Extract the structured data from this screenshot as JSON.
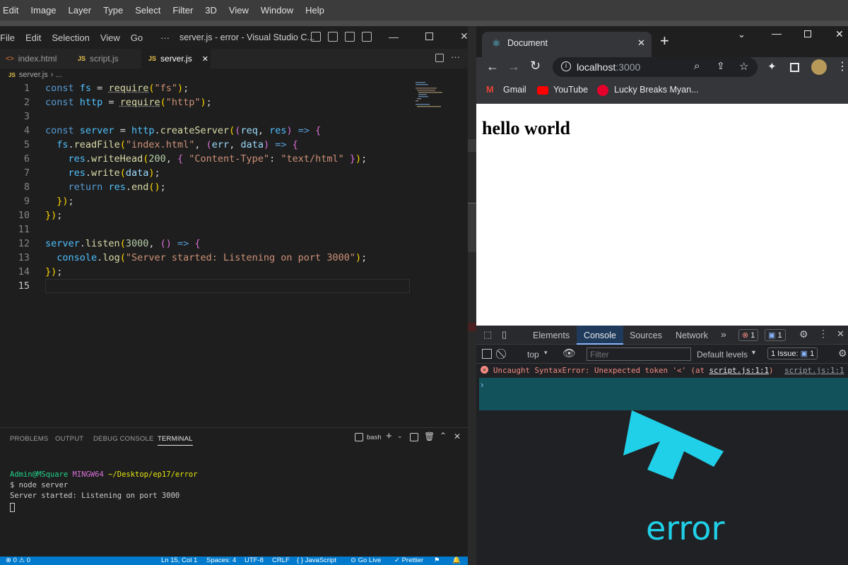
{
  "photoshop": {
    "menu": [
      "Edit",
      "Image",
      "Layer",
      "Type",
      "Select",
      "Filter",
      "3D",
      "View",
      "Window",
      "Help"
    ]
  },
  "vscode": {
    "menu": [
      "File",
      "Edit",
      "Selection",
      "View",
      "Go"
    ],
    "more": "···",
    "window_title": "server.js - error - Visual Studio C...",
    "tabs": [
      {
        "icon": "<>",
        "label": "index.html"
      },
      {
        "icon": "JS",
        "label": "script.js"
      },
      {
        "icon": "JS",
        "label": "server.js",
        "close": "✕"
      }
    ],
    "breadcrumb": {
      "icon": "JS",
      "file": "server.js",
      "rest": "› ..."
    },
    "line_numbers": [
      "1",
      "2",
      "3",
      "4",
      "5",
      "6",
      "7",
      "8",
      "9",
      "10",
      "11",
      "12",
      "13",
      "14",
      "15"
    ],
    "code_lines": [
      "const fs = require(\"fs\");",
      "const http = require(\"http\");",
      "",
      "const server = http.createServer((req, res) => {",
      "  fs.readFile(\"index.html\", (err, data) => {",
      "    res.writeHead(200, { \"Content-Type\": \"text/html\" });",
      "    res.write(data);",
      "    return res.end();",
      "  });",
      "});",
      "",
      "server.listen(3000, () => {",
      "  console.log(\"Server started: Listening on port 3000\");",
      "});",
      ""
    ],
    "panel_tabs": [
      "PROBLEMS",
      "OUTPUT",
      "DEBUG CONSOLE",
      "TERMINAL"
    ],
    "terminal_shell": "bash",
    "terminal": {
      "user": "Admin@MSquare",
      "env": "MINGW64",
      "path": "~/Desktop/ep17/error",
      "command": "$ node server",
      "output": "Server started: Listening on port 3000"
    },
    "status": {
      "problems": "⊗ 0 ⚠ 0",
      "position": "Ln 15, Col 1",
      "spaces": "Spaces: 4",
      "encoding": "UTF-8",
      "eol": "CRLF",
      "language": "{ } JavaScript",
      "golive": "⊙ Go Live",
      "prettier": "✓ Prettier"
    },
    "colors": {
      "accent": "#007acc",
      "editor_bg": "#1e1e1e"
    }
  },
  "chrome": {
    "tab_title": "Document",
    "tab_close": "✕",
    "new_tab": "+",
    "url_host": "localhost",
    "url_port": ":3000",
    "bookmarks": [
      "Gmail",
      "YouTube",
      "Lucky Breaks Myan..."
    ],
    "page_heading": "hello world",
    "devtools": {
      "tabs": [
        "Elements",
        "Console",
        "Sources",
        "Network"
      ],
      "more": "»",
      "error_count": "1",
      "message_count": "1",
      "context": "top",
      "filter_placeholder": "Filter",
      "levels": "Default levels",
      "issues_label": "1 Issue:",
      "issues_count": "1",
      "error_message": "Uncaught SyntaxError: Unexpected token '<' (at",
      "error_location": "script.js:1:1",
      "error_close": ")",
      "error_source": "script.js:1:1",
      "prompt": "›"
    },
    "annotation": "error",
    "colors": {
      "annotation": "#1fd0e8",
      "error": "#f28b82",
      "active_row": "#12535b"
    }
  }
}
